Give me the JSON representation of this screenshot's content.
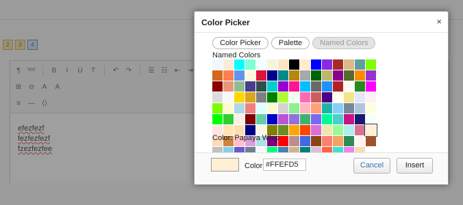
{
  "background": {
    "pager": [
      "2",
      "3",
      "4"
    ],
    "toolbar_icons": [
      [
        "pilcrow-icon",
        "¶"
      ],
      [
        "text-style-icon",
        "ᵗᵉˣᵗ"
      ],
      [
        "bold-icon",
        "B"
      ],
      [
        "italic-icon",
        "I"
      ],
      [
        "underline-icon",
        "U"
      ],
      [
        "strikethrough-icon",
        "T"
      ],
      [
        "undo-icon",
        "↶"
      ],
      [
        "redo-icon",
        "↷"
      ],
      [
        "bullet-list-icon",
        "☰"
      ],
      [
        "numbered-list-icon",
        "☷"
      ],
      [
        "outdent-icon",
        "⇤"
      ],
      [
        "indent-icon",
        "⇥"
      ]
    ],
    "toolbar_icons_2": [
      [
        "table-icon",
        "⊞"
      ],
      [
        "link-icon",
        "⊖"
      ],
      [
        "text-color-icon",
        "A"
      ],
      [
        "highlight-icon",
        "A"
      ]
    ],
    "toolbar_icons_3": [
      [
        "align-icon",
        "≡"
      ],
      [
        "horizontal-rule-icon",
        "—"
      ],
      [
        "code-icon",
        "⟨⟩"
      ]
    ],
    "doc_lines": [
      "efezfezf",
      "fezfezfezf",
      "fzezfezfee"
    ]
  },
  "dialog": {
    "title": "Color Picker",
    "close_symbol": "×",
    "tabs": [
      "Color Picker",
      "Palette",
      "Named Colors"
    ],
    "active_tab": "Named Colors",
    "named_colors_label": "Named Colors",
    "colors": [
      "#F0F8FF",
      "#FAEBD7",
      "#00FFFF",
      "#7FFFD4",
      "#F0FFFF",
      "#F5F5DC",
      "#FFE4C4",
      "#000000",
      "#FFEBCD",
      "#0000FF",
      "#8A2BE2",
      "#A52A2A",
      "#DEB887",
      "#5F9EA0",
      "#7FFF00",
      "#D2691E",
      "#FF7F50",
      "#6495ED",
      "#FFF8DC",
      "#DC143C",
      "#00008B",
      "#008B8B",
      "#B8860B",
      "#A9A9A9",
      "#006400",
      "#BDB76B",
      "#8B008B",
      "#556B2F",
      "#FF8C00",
      "#9932CC",
      "#8B0000",
      "#E9967A",
      "#8FBC8F",
      "#483D8B",
      "#2F4F4F",
      "#00CED1",
      "#9400D3",
      "#FF1493",
      "#00BFFF",
      "#696969",
      "#1E90FF",
      "#B22222",
      "#FFFAF0",
      "#228B22",
      "#FF00FF",
      "#DCDCDC",
      "#F8F8FF",
      "#FFD700",
      "#DAA520",
      "#808080",
      "#008000",
      "#ADFF2F",
      "#F0FFF0",
      "#FF69B4",
      "#CD5C5C",
      "#4B0082",
      "#FFFFF0",
      "#F0E68C",
      "#E6E6FA",
      "#FFF0F5",
      "#7CFC00",
      "#FFFACD",
      "#ADD8E6",
      "#F08080",
      "#E0FFFF",
      "#FAFAD2",
      "#D3D3D3",
      "#90EE90",
      "#FFB6C1",
      "#FFA07A",
      "#20B2AA",
      "#87CEFA",
      "#778899",
      "#B0C4DE",
      "#FFFFE0",
      "#00FF00",
      "#32CD32",
      "#FAF0E6",
      "#800000",
      "#66CDAA",
      "#0000CD",
      "#BA55D3",
      "#9370DB",
      "#3CB371",
      "#7B68EE",
      "#00FA9A",
      "#48D1CC",
      "#C71585",
      "#191970",
      "#F5FFFA",
      "#FFE4E1",
      "#FFE4B5",
      "#FFDEAD",
      "#000080",
      "#FDF5E6",
      "#808000",
      "#6B8E23",
      "#FFA500",
      "#FF4500",
      "#DA70D6",
      "#EEE8AA",
      "#98FB98",
      "#AFEEEE",
      "#DB7093",
      "#FFEFD5",
      "#FFDAB9",
      "#CD853F",
      "#FFC0CB",
      "#DDA0DD",
      "#B0E0E6",
      "#800080",
      "#FF0000",
      "#BC8F8F",
      "#4169E1",
      "#8B4513",
      "#FA8072",
      "#F4A460",
      "#2E8B57",
      "#FFF5EE",
      "#A0522D",
      "#C0C0C0",
      "#87CEEB",
      "#6A5ACD",
      "#708090",
      "#FFFAFA",
      "#00FF7F",
      "#4682B4",
      "#D2B48C",
      "#008080",
      "#D8BFD8",
      "#FF6347",
      "#40E0D0",
      "#EE82EE",
      "#F5DEB3",
      "#FFFFFF",
      "#F5F5F5",
      "#FFFF00",
      "#9ACD32"
    ],
    "selected_color": "#FFEFD5",
    "color_name_text": "Color: Papaya Whip",
    "preview_color": "#FFEFD5",
    "color_label": "Color:",
    "color_value": "#FFEFD5",
    "cancel_label": "Cancel",
    "insert_label": "Insert"
  }
}
